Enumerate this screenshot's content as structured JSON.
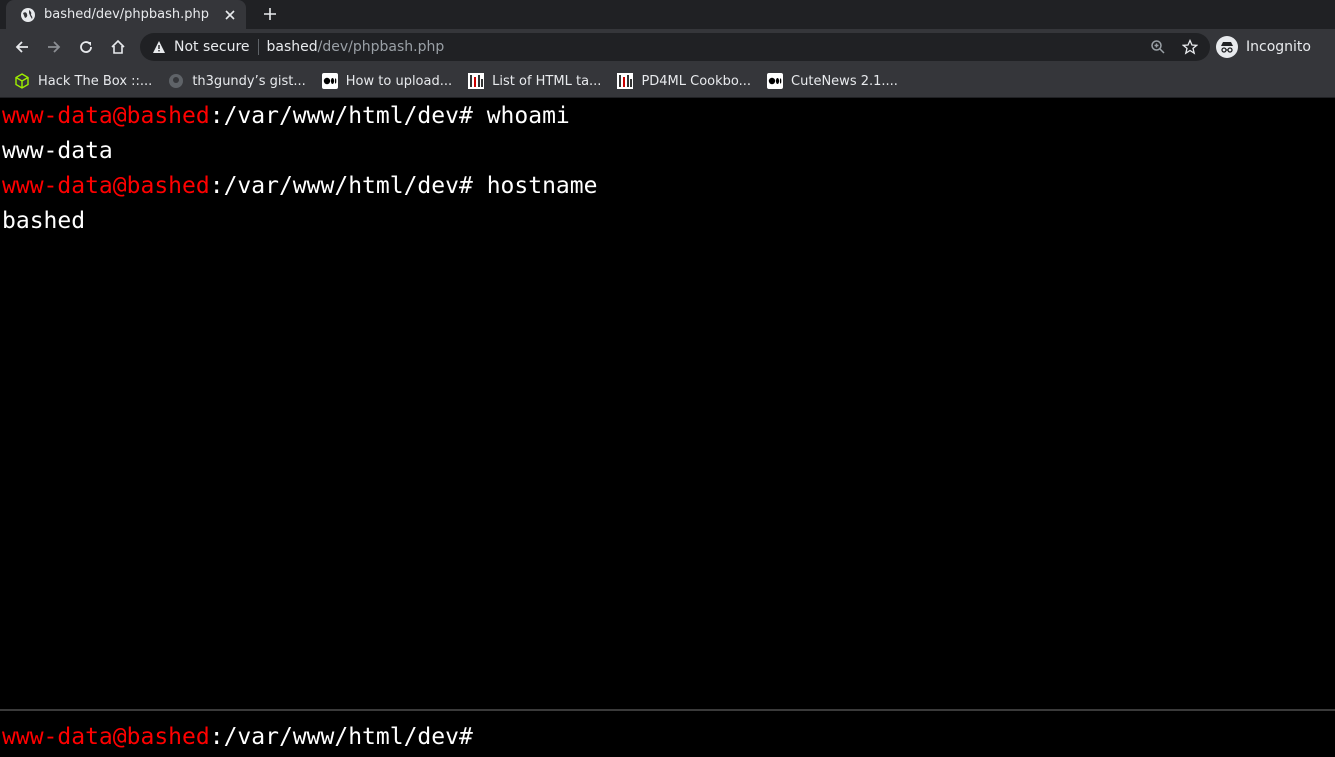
{
  "tab": {
    "title": "bashed/dev/phpbash.php",
    "favicon": "globe-icon"
  },
  "toolbar": {
    "security_label": "Not secure",
    "url_host": "bashed",
    "url_path": "/dev/phpbash.php",
    "profile_label": "Incognito"
  },
  "bookmarks": [
    {
      "label": "Hack The Box ::...",
      "icon": "htb-cube-icon",
      "color": "#9fef00"
    },
    {
      "label": "th3gundy’s gist...",
      "icon": "github-icon",
      "color": "#5f6368"
    },
    {
      "label": "How to upload...",
      "icon": "medium-icon",
      "color": "#ffffff"
    },
    {
      "label": "List of HTML ta...",
      "icon": "pd4ml-icon",
      "color": "#ffffff"
    },
    {
      "label": "PD4ML Cookbo...",
      "icon": "pd4ml-icon",
      "color": "#ffffff"
    },
    {
      "label": "CuteNews 2.1....",
      "icon": "medium-icon",
      "color": "#ffffff"
    }
  ],
  "terminal": {
    "prompt_user": "www-data@bashed",
    "prompt_path": ":/var/www/html/dev#",
    "lines": [
      {
        "type": "prompt",
        "command": "whoami"
      },
      {
        "type": "output",
        "text": "www-data"
      },
      {
        "type": "prompt",
        "command": "hostname"
      },
      {
        "type": "output",
        "text": "bashed"
      }
    ],
    "input_value": ""
  },
  "colors": {
    "prompt_user": "#ff0000",
    "background": "#000000",
    "chrome_dark": "#202124",
    "chrome_toolbar": "#35363a"
  }
}
